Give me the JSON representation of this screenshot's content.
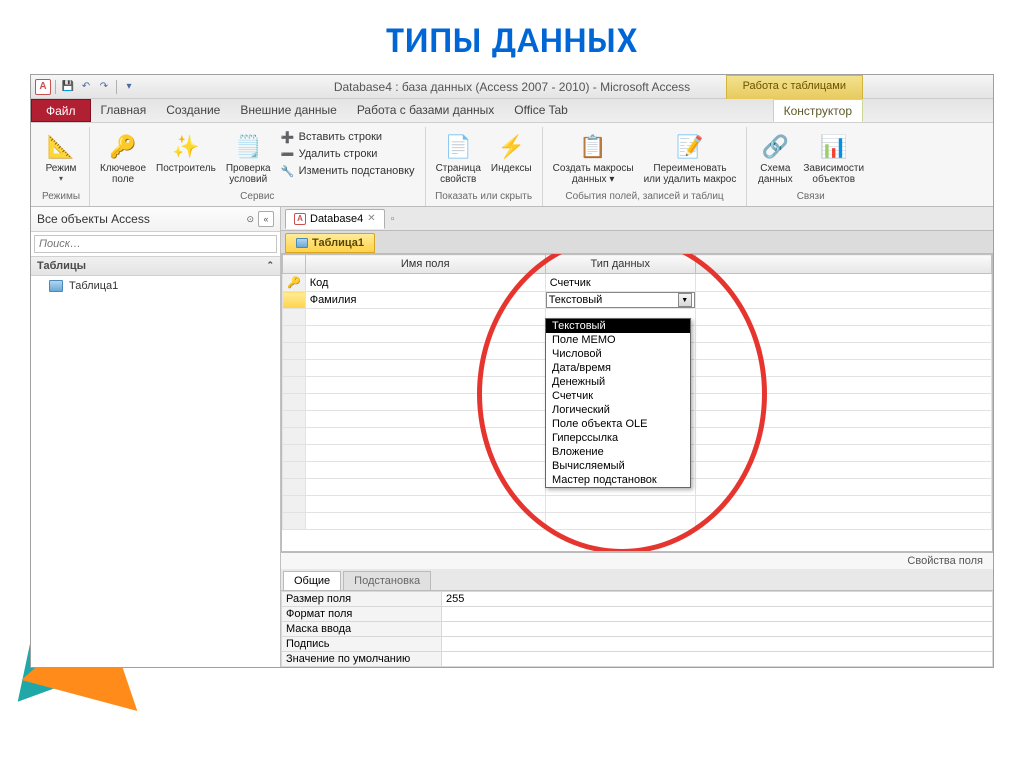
{
  "slide": {
    "title": "ТИПЫ ДАННЫХ"
  },
  "titlebar": {
    "app_title": "Database4 : база данных (Access 2007 - 2010)  -  Microsoft Access",
    "context_header": "Работа с таблицами"
  },
  "tabs": {
    "file": "Файл",
    "home": "Главная",
    "create": "Создание",
    "external": "Внешние данные",
    "dbtools": "Работа с базами данных",
    "officetab": "Office Tab",
    "designer": "Конструктор"
  },
  "ribbon": {
    "modes": {
      "view": "Режим",
      "group": "Режимы"
    },
    "tools": {
      "pk": "Ключевое\nполе",
      "builder": "Построитель",
      "validation": "Проверка\nусловий",
      "group": "Сервис",
      "insert_rows": "Вставить строки",
      "delete_rows": "Удалить строки",
      "modify_lookup": "Изменить подстановку"
    },
    "showhide": {
      "propsheet": "Страница\nсвойств",
      "indexes": "Индексы",
      "group": "Показать или скрыть"
    },
    "events": {
      "create_macros": "Создать макросы\nданных ▾",
      "rename_delete": "Переименовать\nили удалить макрос",
      "group": "События полей, записей и таблиц"
    },
    "rel": {
      "schema": "Схема\nданных",
      "deps": "Зависимости\nобъектов",
      "group": "Связи"
    }
  },
  "nav": {
    "header": "Все объекты Access",
    "search_placeholder": "Поиск…",
    "group_tables": "Таблицы",
    "item1": "Таблица1"
  },
  "doctab": {
    "name": "Database4"
  },
  "subtab": {
    "name": "Таблица1"
  },
  "design": {
    "col_name": "Имя поля",
    "col_type": "Тип данных",
    "rows": [
      {
        "name": "Код",
        "type": "Счетчик",
        "pk": true
      },
      {
        "name": "Фамилия",
        "type": "Текстовый",
        "pk": false
      }
    ],
    "dropdown_options": [
      "Текстовый",
      "Поле МЕМО",
      "Числовой",
      "Дата/время",
      "Денежный",
      "Счетчик",
      "Логический",
      "Поле объекта OLE",
      "Гиперссылка",
      "Вложение",
      "Вычисляемый",
      "Мастер подстановок"
    ],
    "dropdown_selected": "Текстовый"
  },
  "props": {
    "section_label": "Свойства поля",
    "tab_general": "Общие",
    "tab_lookup": "Подстановка",
    "rows": [
      {
        "name": "Размер поля",
        "value": "255"
      },
      {
        "name": "Формат поля",
        "value": ""
      },
      {
        "name": "Маска ввода",
        "value": ""
      },
      {
        "name": "Подпись",
        "value": ""
      },
      {
        "name": "Значение по умолчанию",
        "value": ""
      }
    ]
  }
}
